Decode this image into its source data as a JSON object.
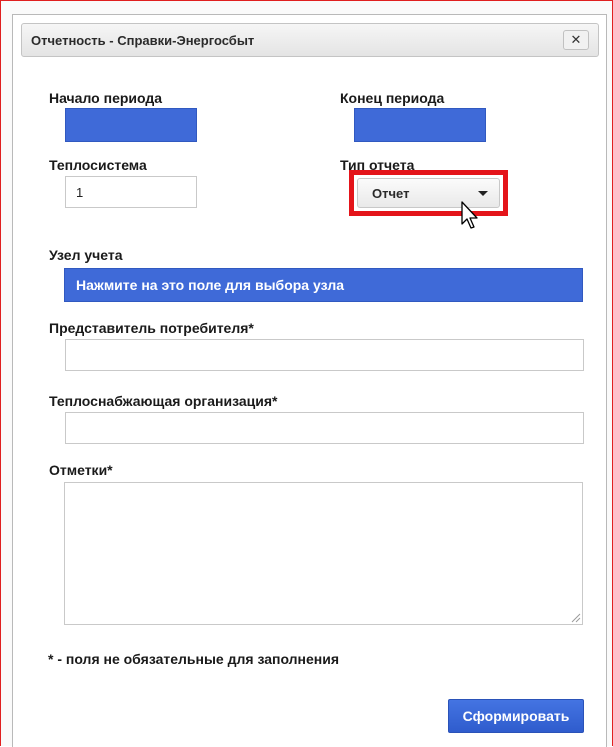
{
  "dialog": {
    "title": "Отчетность - Справки-Энергосбыт",
    "close_label": "✕"
  },
  "fields": {
    "period_start": {
      "label": "Начало периода",
      "value": ""
    },
    "period_end": {
      "label": "Конец периода",
      "value": ""
    },
    "heat_system": {
      "label": "Теплосистема",
      "value": "1"
    },
    "report_type": {
      "label": "Тип отчета",
      "value": "Отчет"
    },
    "metering_node": {
      "label": "Узел учета",
      "value": "Нажмите на это поле для выбора узла"
    },
    "consumer_rep": {
      "label": "Представитель потребителя*",
      "value": ""
    },
    "heat_supplier": {
      "label": "Теплоснабжающая организация*",
      "value": ""
    },
    "remarks": {
      "label": "Отметки*",
      "value": ""
    }
  },
  "note": "* - поля не обязательные для заполнения",
  "actions": {
    "submit_label": "Сформировать"
  },
  "colors": {
    "accent": "#3f6ad8",
    "highlight": "#e4141a"
  }
}
